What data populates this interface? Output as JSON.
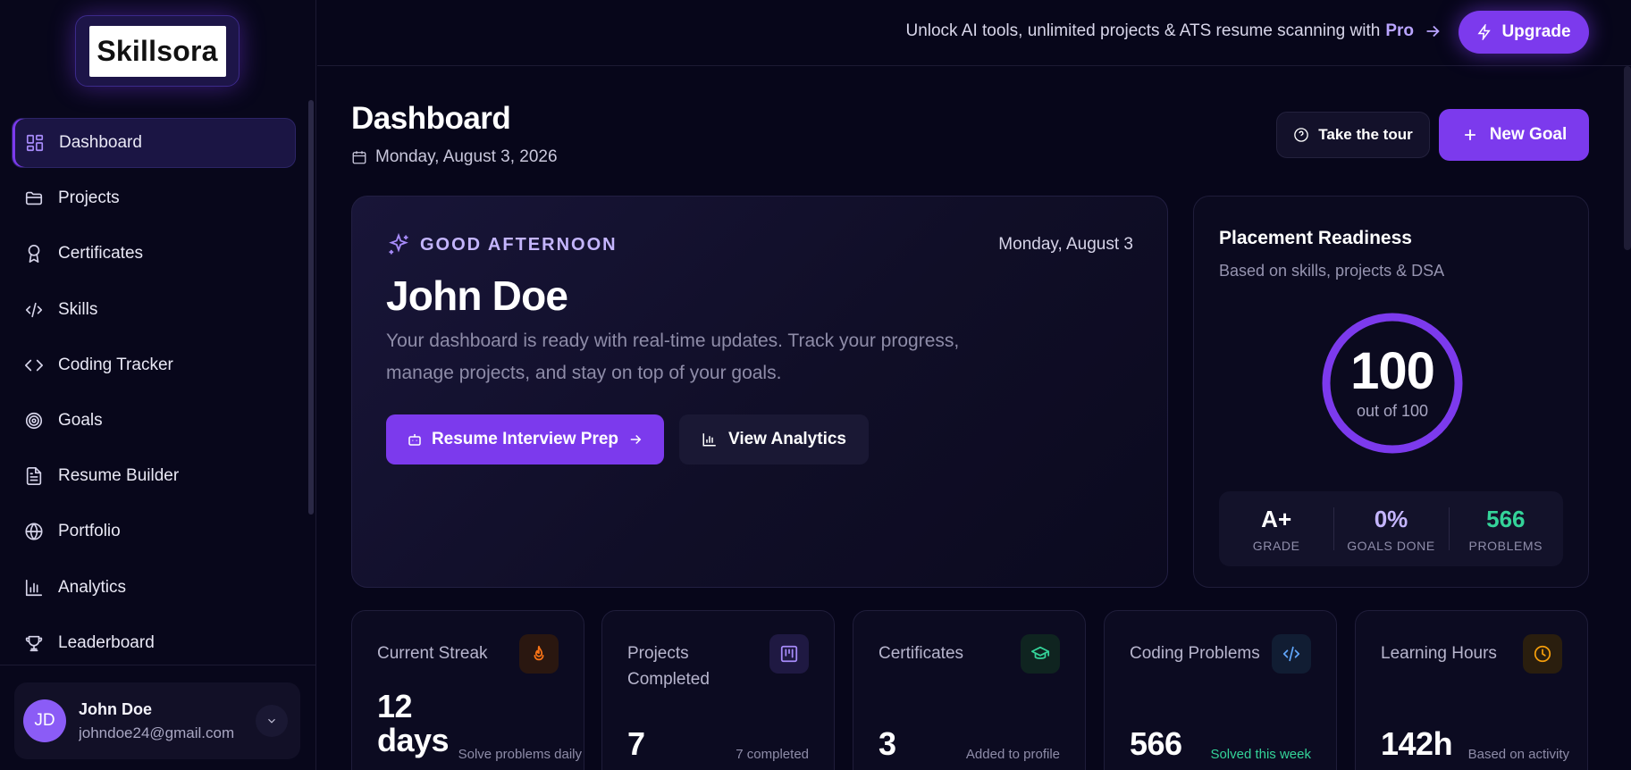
{
  "brand": {
    "logo_text": "Skillsora"
  },
  "sidebar": {
    "items": [
      {
        "label": "Dashboard",
        "icon": "grid-icon",
        "active": true
      },
      {
        "label": "Projects",
        "icon": "folder-icon"
      },
      {
        "label": "Certificates",
        "icon": "award-icon"
      },
      {
        "label": "Skills",
        "icon": "code-icon"
      },
      {
        "label": "Coding Tracker",
        "icon": "chevrons-code-icon"
      },
      {
        "label": "Goals",
        "icon": "target-icon"
      },
      {
        "label": "Resume Builder",
        "icon": "file-text-icon"
      },
      {
        "label": "Portfolio",
        "icon": "globe-icon"
      },
      {
        "label": "Analytics",
        "icon": "bar-chart-icon"
      },
      {
        "label": "Leaderboard",
        "icon": "trophy-icon"
      }
    ],
    "user": {
      "initials": "JD",
      "name": "John Doe",
      "email": "johndoe24@gmail.com"
    }
  },
  "topbar": {
    "promo_text": "Unlock AI tools, unlimited projects & ATS resume scanning with",
    "promo_pro": "Pro",
    "upgrade_label": "Upgrade"
  },
  "header": {
    "title": "Dashboard",
    "date": "Monday, August 3, 2026",
    "tour_label": "Take the tour",
    "new_goal_label": "New Goal"
  },
  "welcome": {
    "greeting": "GOOD AFTERNOON",
    "date": "Monday, August 3",
    "name": "John Doe",
    "description": "Your dashboard is ready with real-time updates. Track your progress, manage projects, and stay on top of your goals.",
    "primary_button": "Resume Interview Prep",
    "secondary_button": "View Analytics"
  },
  "readiness": {
    "title": "Placement Readiness",
    "subtitle": "Based on skills, projects & DSA",
    "score": "100",
    "score_max": "out of 100",
    "score_fraction": 1.0,
    "stats": [
      {
        "value": "A+",
        "label": "GRADE",
        "color": "white"
      },
      {
        "value": "0%",
        "label": "GOALS DONE",
        "color": "purple"
      },
      {
        "value": "566",
        "label": "PROBLEMS",
        "color": "green"
      }
    ]
  },
  "stats": [
    {
      "label": "Current Streak",
      "value": "12 days",
      "note": "Solve problems daily",
      "icon": "flame-icon",
      "accent": "#f97316"
    },
    {
      "label": "Projects Completed",
      "value": "7",
      "note": "7 completed",
      "icon": "kanban-icon",
      "accent": "#8b5cf6"
    },
    {
      "label": "Certificates",
      "value": "3",
      "note": "Added to profile",
      "icon": "graduation-cap-icon",
      "accent": "#34d399"
    },
    {
      "label": "Coding Problems",
      "value": "566",
      "note": "Solved this week",
      "icon": "code-icon",
      "accent": "#60a5fa"
    },
    {
      "label": "Learning Hours",
      "value": "142h",
      "note": "Based on activity",
      "icon": "clock-icon",
      "accent": "#f59e0b"
    }
  ],
  "colors": {
    "accent": "#7c3aed",
    "background": "#07061a",
    "success": "#34d399"
  }
}
